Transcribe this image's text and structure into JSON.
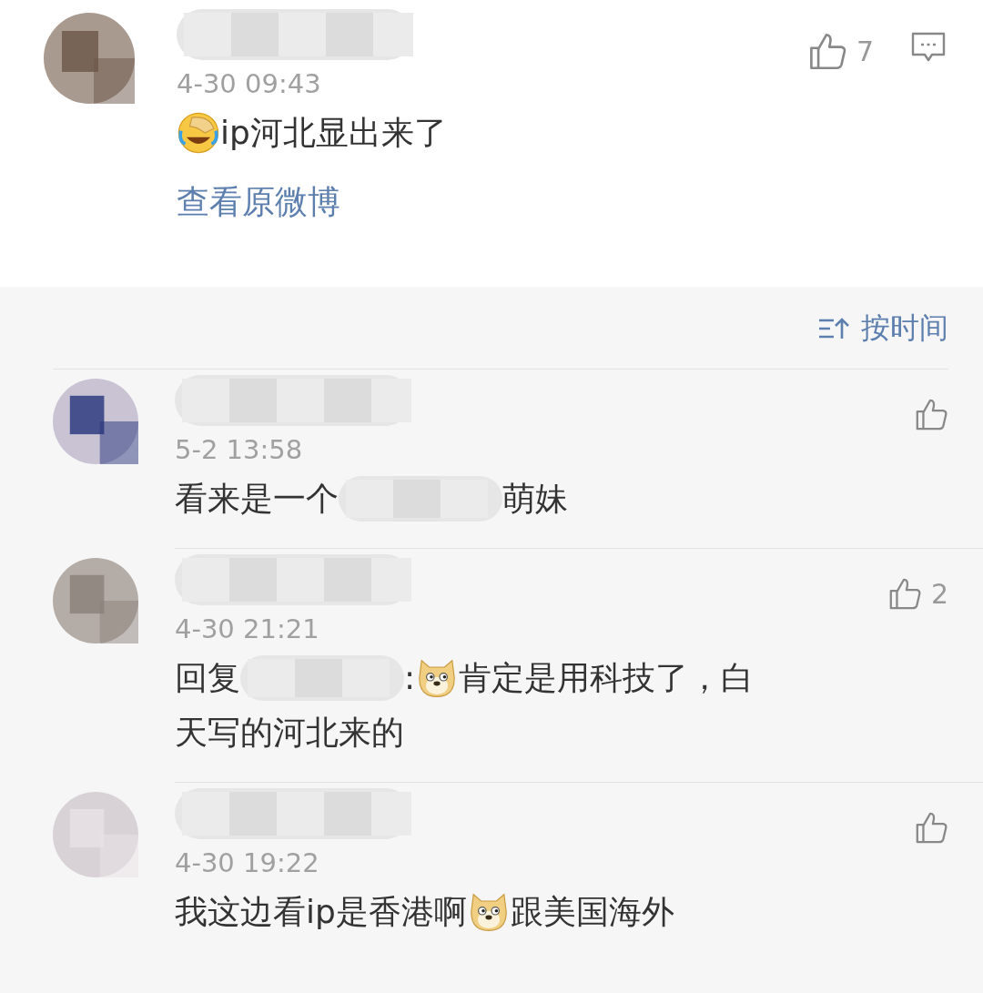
{
  "post_comment": {
    "time": "4-30 09:43",
    "likes": "7",
    "body": [
      {
        "kind": "laugh_emoji"
      },
      {
        "kind": "text",
        "text": "ip河北显出来了"
      }
    ],
    "view_original": "查看原微博"
  },
  "sort": {
    "label": "按时间"
  },
  "replies": [
    {
      "time": "5-2 13:58",
      "body": [
        {
          "kind": "text",
          "text": "看来是一个"
        },
        {
          "kind": "redacted"
        },
        {
          "kind": "text",
          "text": "萌妹"
        }
      ]
    },
    {
      "time": "4-30 21:21",
      "likes": "2",
      "body": [
        {
          "kind": "text",
          "text": "回复"
        },
        {
          "kind": "redacted"
        },
        {
          "kind": "text",
          "text": ":"
        },
        {
          "kind": "dog_emoji"
        },
        {
          "kind": "text",
          "text": "肯定是用科技了，白"
        },
        {
          "kind": "text",
          "text": "天写的河北来的"
        }
      ]
    },
    {
      "time": "4-30 19:22",
      "body": [
        {
          "kind": "text",
          "text": "我这边看ip是香港啊"
        },
        {
          "kind": "dog_emoji"
        },
        {
          "kind": "text",
          "text": "跟美国海外"
        }
      ]
    }
  ]
}
